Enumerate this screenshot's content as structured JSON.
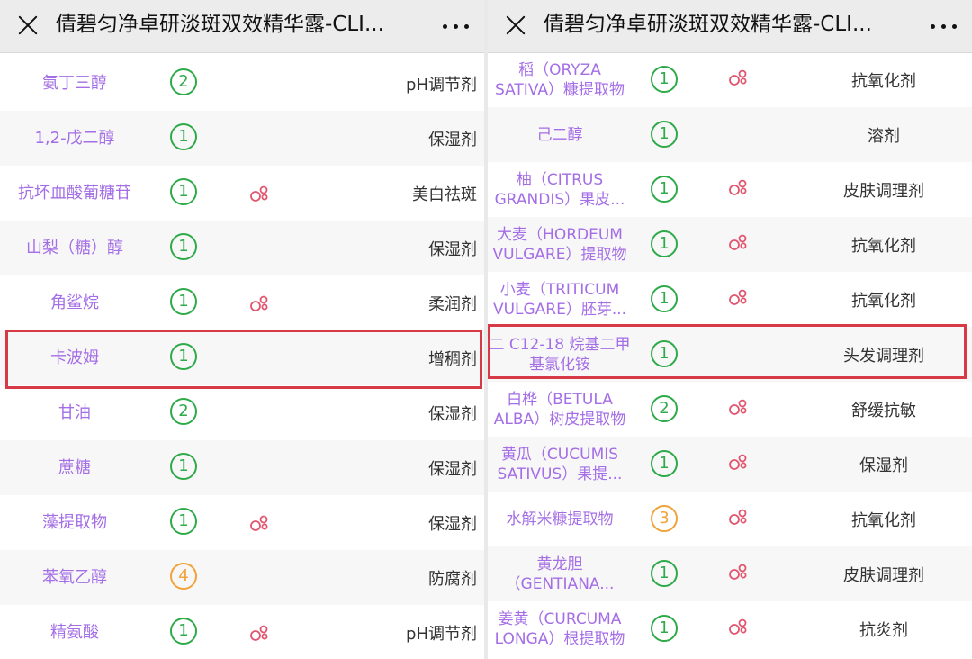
{
  "panels": [
    {
      "title": "倩碧匀净卓研淡斑双效精华露-CLI...",
      "highlight_row": 5,
      "rows": [
        {
          "name": "氨丁三醇",
          "score": "2",
          "score_color": "#2eaa4a",
          "acne": false,
          "function": "pH调节剂"
        },
        {
          "name": "1,2-戊二醇",
          "score": "1",
          "score_color": "#2eaa4a",
          "acne": false,
          "function": "保湿剂"
        },
        {
          "name": "抗坏血酸葡糖苷",
          "score": "1",
          "score_color": "#2eaa4a",
          "acne": true,
          "function": "美白祛斑"
        },
        {
          "name": "山梨（糖）醇",
          "score": "1",
          "score_color": "#2eaa4a",
          "acne": false,
          "function": "保湿剂"
        },
        {
          "name": "角鲨烷",
          "score": "1",
          "score_color": "#2eaa4a",
          "acne": true,
          "function": "柔润剂"
        },
        {
          "name": "卡波姆",
          "score": "1",
          "score_color": "#2eaa4a",
          "acne": false,
          "function": "增稠剂"
        },
        {
          "name": "甘油",
          "score": "2",
          "score_color": "#2eaa4a",
          "acne": false,
          "function": "保湿剂"
        },
        {
          "name": "蔗糖",
          "score": "1",
          "score_color": "#2eaa4a",
          "acne": false,
          "function": "保湿剂"
        },
        {
          "name": "藻提取物",
          "score": "1",
          "score_color": "#2eaa4a",
          "acne": true,
          "function": "保湿剂"
        },
        {
          "name": "苯氧乙醇",
          "score": "4",
          "score_color": "#f0a33a",
          "acne": false,
          "function": "防腐剂"
        },
        {
          "name": "精氨酸",
          "score": "1",
          "score_color": "#2eaa4a",
          "acne": true,
          "function": "pH调节剂"
        }
      ]
    },
    {
      "title": "倩碧匀净卓研淡斑双效精华露-CLI...",
      "highlight_row": 5,
      "rows": [
        {
          "name": "稻（ORYZA SATIVA）糠提取物",
          "score": "1",
          "score_color": "#2eaa4a",
          "acne": true,
          "function": "抗氧化剂"
        },
        {
          "name": "己二醇",
          "score": "1",
          "score_color": "#2eaa4a",
          "acne": false,
          "function": "溶剂"
        },
        {
          "name": "柚（CITRUS GRANDIS）果皮...",
          "score": "1",
          "score_color": "#2eaa4a",
          "acne": true,
          "function": "皮肤调理剂"
        },
        {
          "name": "大麦（HORDEUM VULGARE）提取物",
          "score": "1",
          "score_color": "#2eaa4a",
          "acne": true,
          "function": "抗氧化剂"
        },
        {
          "name": "小麦（TRITICUM VULGARE）胚芽...",
          "score": "1",
          "score_color": "#2eaa4a",
          "acne": true,
          "function": "抗氧化剂"
        },
        {
          "name": "二 C12-18 烷基二甲基氯化铵",
          "score": "1",
          "score_color": "#2eaa4a",
          "acne": false,
          "function": "头发调理剂"
        },
        {
          "name": "白桦（BETULA ALBA）树皮提取物",
          "score": "2",
          "score_color": "#2eaa4a",
          "acne": true,
          "function": "舒缓抗敏"
        },
        {
          "name": "黄瓜（CUCUMIS SATIVUS）果提...",
          "score": "1",
          "score_color": "#2eaa4a",
          "acne": true,
          "function": "保湿剂"
        },
        {
          "name": "水解米糠提取物",
          "score": "3",
          "score_color": "#f0a33a",
          "acne": true,
          "function": "抗氧化剂"
        },
        {
          "name": "黄龙胆（GENTIANA...",
          "score": "1",
          "score_color": "#2eaa4a",
          "acne": true,
          "function": "皮肤调理剂"
        },
        {
          "name": "姜黄（CURCUMA LONGA）根提取物",
          "score": "1",
          "score_color": "#2eaa4a",
          "acne": true,
          "function": "抗炎剂"
        }
      ]
    }
  ],
  "icons": {
    "close": "close-icon",
    "more": "more-options-icon",
    "acne": "acne-risk-icon"
  },
  "colors": {
    "name_text": "#a46ee6",
    "safety_green": "#2eaa4a",
    "safety_orange": "#f0a33a",
    "highlight_border": "#d63a47",
    "acne_icon": "#e2556f"
  }
}
